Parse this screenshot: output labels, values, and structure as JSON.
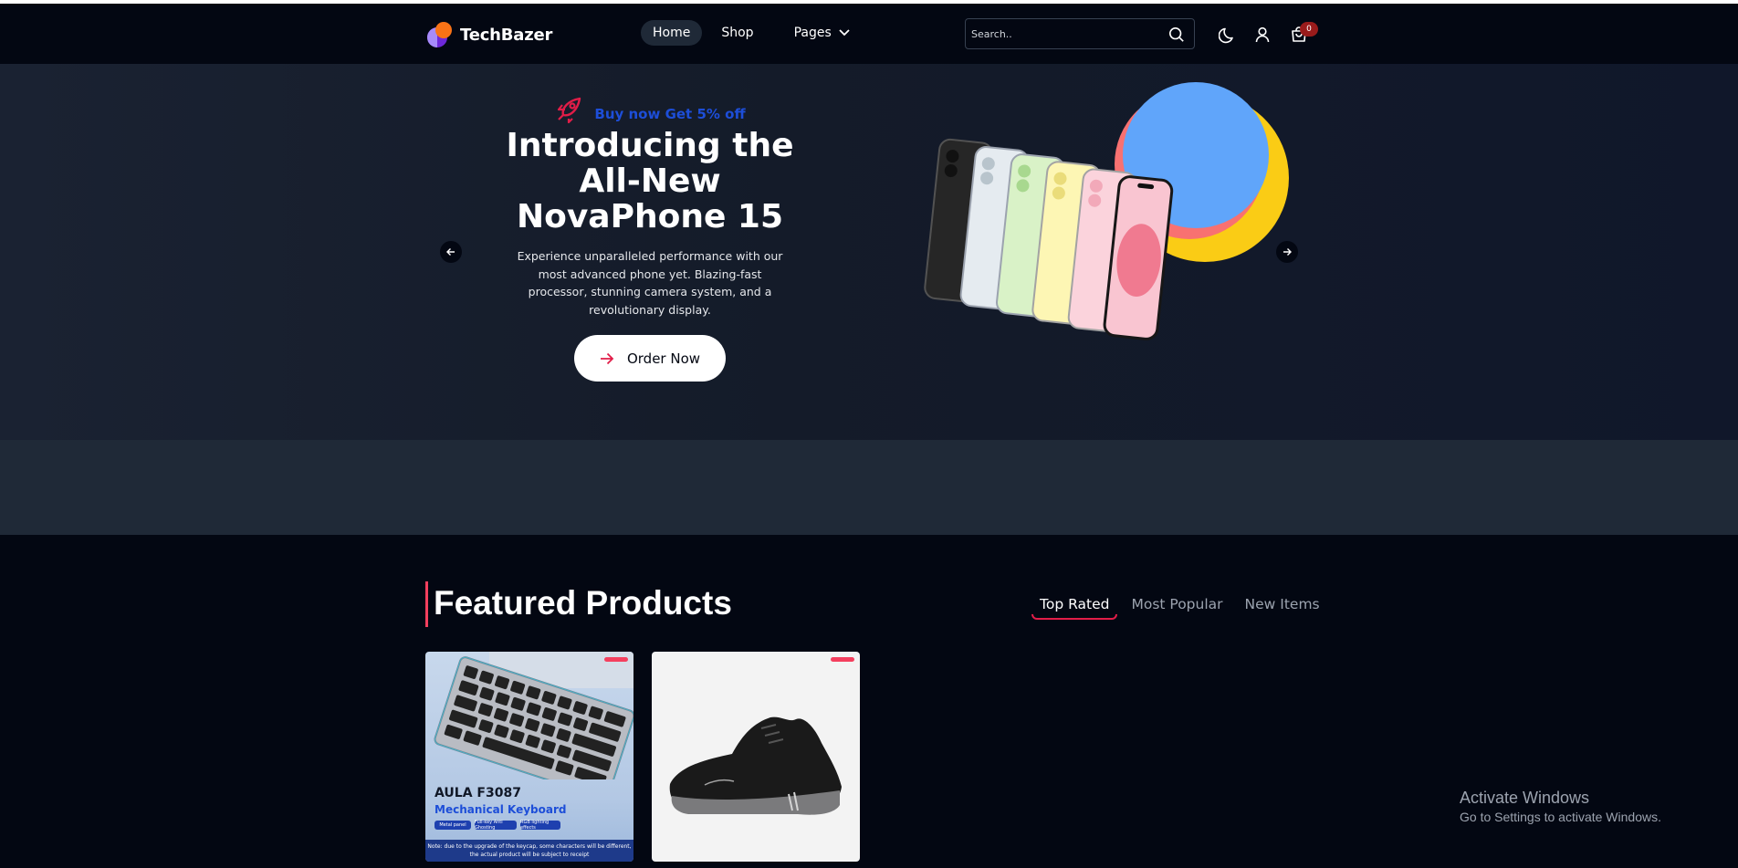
{
  "brand": {
    "name": "TechBazer"
  },
  "nav": {
    "links": [
      {
        "label": "Home",
        "active": true
      },
      {
        "label": "Shop",
        "active": false
      },
      {
        "label": "Pages",
        "active": false
      }
    ]
  },
  "search": {
    "placeholder": "Search.."
  },
  "header": {
    "cart_count": "0"
  },
  "hero": {
    "promo": "Buy now Get 5% off",
    "title_line1": "Introducing the",
    "title_line2": "All-New",
    "title_line3": "NovaPhone 15",
    "description": "Experience unparalleled performance with our most advanced phone yet. Blazing-fast processor, stunning camera system, and a revolutionary display.",
    "cta": "Order Now"
  },
  "featured": {
    "title": "Featured Products",
    "tabs": [
      {
        "label": "Top Rated",
        "active": true
      },
      {
        "label": "Most Popular",
        "active": false
      },
      {
        "label": "New Items",
        "active": false
      }
    ]
  },
  "products": [
    {
      "image_title": "AULA F3087",
      "image_subtitle": "Mechanical Keyboard",
      "image_pills": [
        "Metal panel",
        "Full-key Anti Ghosting",
        "RGB lighting effects"
      ],
      "image_note": "Note: due to the upgrade of the keycap, some characters will be different, the actual product will be subject to receipt"
    },
    {}
  ],
  "watermark": {
    "line1": "Activate Windows",
    "line2": "Go to Settings to activate Windows."
  },
  "colors": {
    "background": "#030712",
    "hero": "#141b29",
    "accent": "#f43f5e",
    "promo": "#1d4ed8",
    "badge": "#991b1b"
  }
}
